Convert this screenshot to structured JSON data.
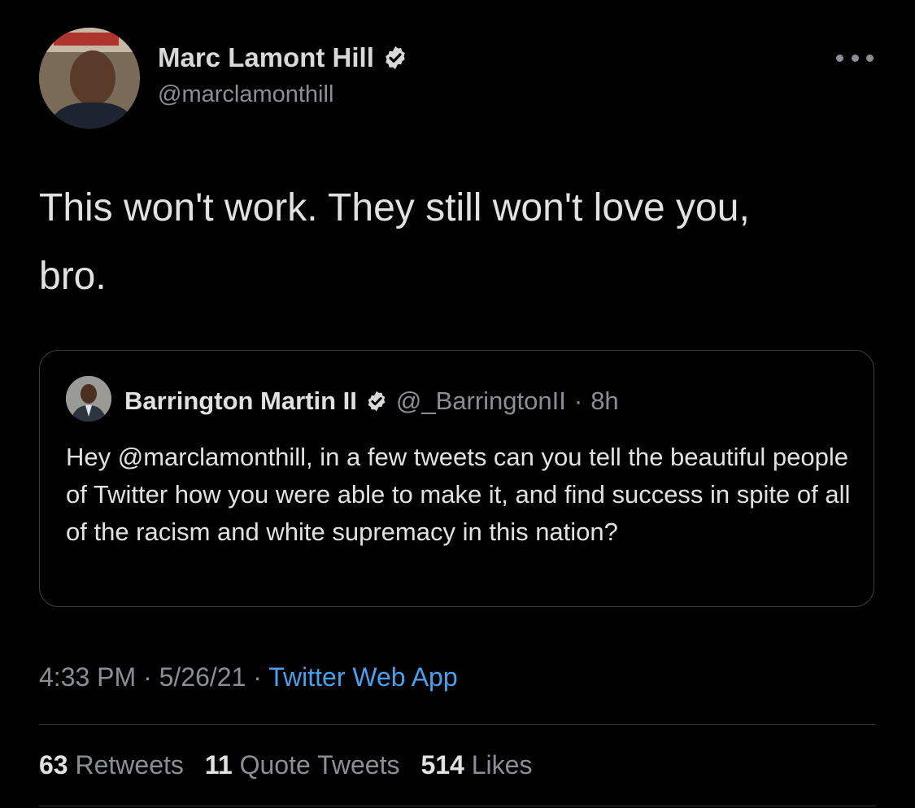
{
  "tweet": {
    "author_name": "Marc Lamont Hill",
    "author_handle": "@marclamonthill",
    "text_line1": "This won't work. They still won't love you,",
    "text_line2": "bro."
  },
  "quoted": {
    "author_name": "Barrington Martin II",
    "author_handle": "@_BarringtonII",
    "separator": "·",
    "age": "8h",
    "text": "Hey @marclamonthill, in a few tweets can you tell the beautiful people of Twitter how you were able to make it, and find success in spite of all of the racism and white supremacy in this nation?"
  },
  "meta": {
    "time": "4:33 PM",
    "sep1": "·",
    "date": "5/26/21",
    "sep2": "·",
    "source": "Twitter Web App"
  },
  "stats": {
    "retweets_count": "63",
    "retweets_label": "Retweets",
    "quotes_count": "11",
    "quotes_label": "Quote Tweets",
    "likes_count": "514",
    "likes_label": "Likes"
  },
  "icons": {
    "verified": "verified-badge-icon",
    "more": "more-options-icon"
  },
  "colors": {
    "background": "#000000",
    "link": "#4aa0eb",
    "secondary_text": "#8b8f94"
  }
}
